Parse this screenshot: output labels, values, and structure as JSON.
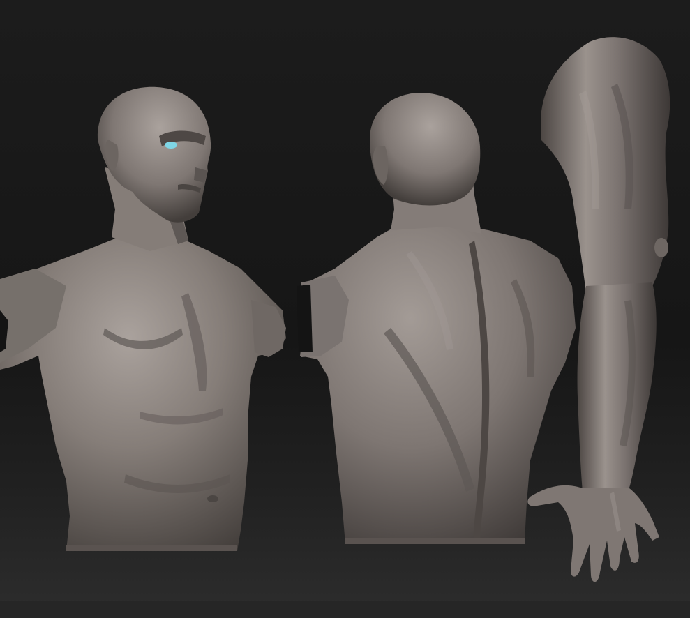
{
  "scene": {
    "background_color": "#181818",
    "clay_color": "#7d7571",
    "clay_highlight": "#b2aba6",
    "clay_shadow": "#3e3a38",
    "eye_color": "#7fd6e6"
  },
  "models": [
    {
      "name": "male-bust-front-view"
    },
    {
      "name": "male-bust-back-view"
    },
    {
      "name": "arm-sculpt-view"
    }
  ]
}
